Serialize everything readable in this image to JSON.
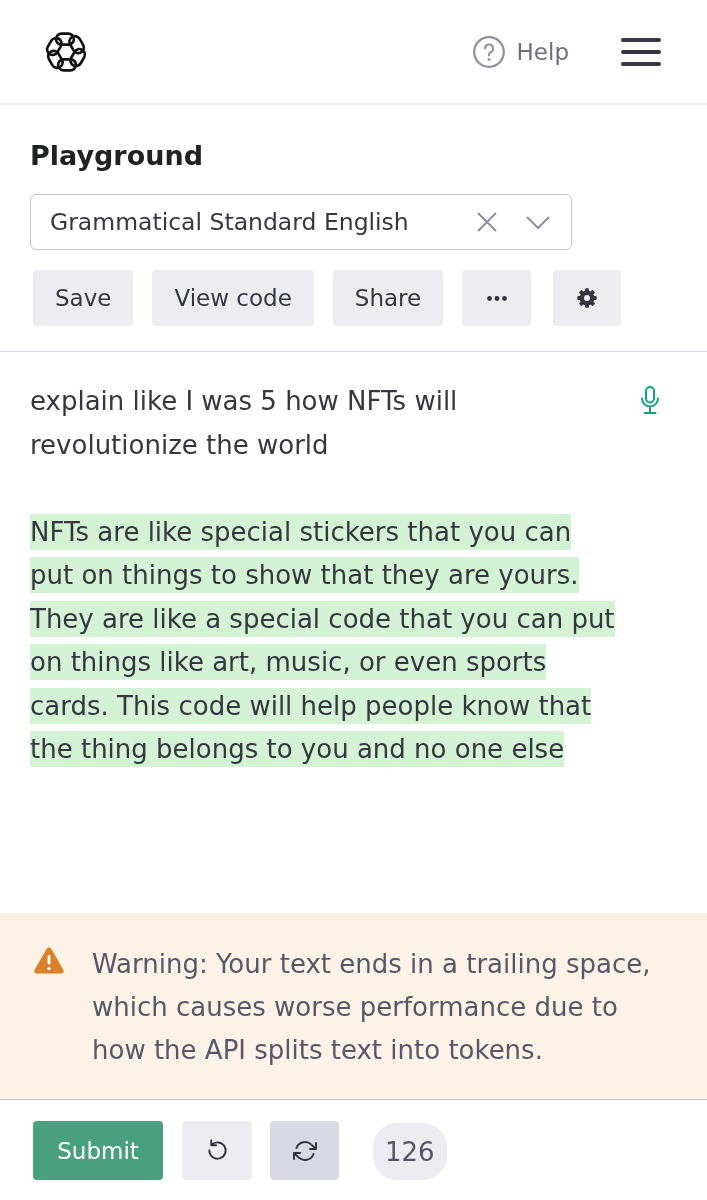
{
  "header": {
    "help_label": "Help"
  },
  "playground": {
    "title": "Playground",
    "preset": {
      "value": "Grammatical Standard English"
    },
    "toolbar": [
      {
        "kind": "save",
        "label": "Save"
      },
      {
        "kind": "view-code",
        "label": "View code"
      },
      {
        "kind": "share",
        "label": "Share"
      },
      {
        "kind": "more"
      },
      {
        "kind": "settings"
      }
    ]
  },
  "editor": {
    "prompt": "explain like I was 5 how NFTs will revolutionize the world",
    "completion": "NFTs are like special stickers that you can put on things to show that they are yours. They are like a special code that you can put on things like art, music, or even sports cards. This code will help people know that the thing belongs to you and no one else"
  },
  "warning": {
    "text": "Warning: Your text ends in a trailing space, which causes worse performance due to how the API splits text into tokens."
  },
  "footer": {
    "submit_label": "Submit",
    "icon_buttons": [
      {
        "kind": "undo",
        "active": false
      },
      {
        "kind": "regenerate",
        "active": true
      }
    ],
    "token_count": "126"
  }
}
